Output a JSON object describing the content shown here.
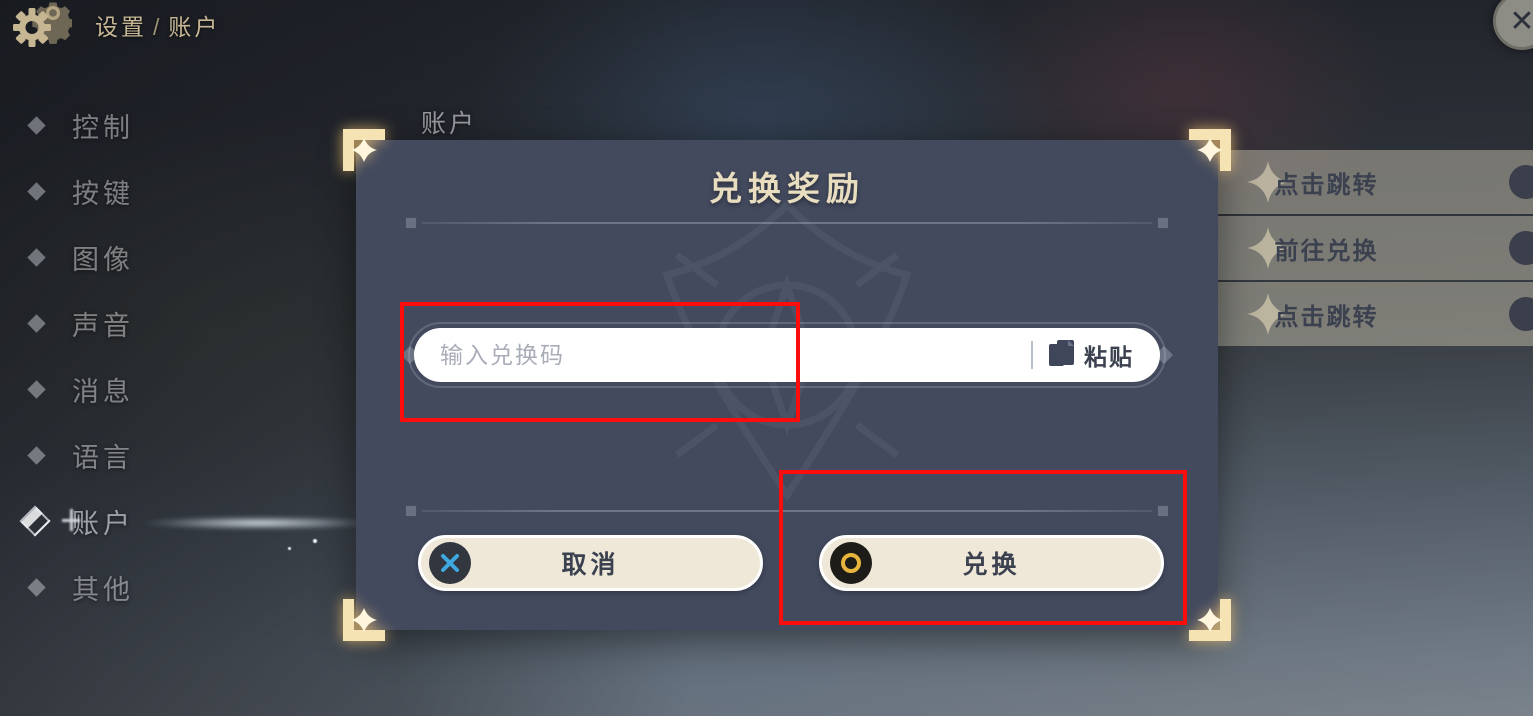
{
  "topbar": {
    "gear_icon": "gear-icon",
    "breadcrumb_root": "设置",
    "breadcrumb_sep": "/",
    "breadcrumb_current": "账户",
    "close_icon": "✕"
  },
  "sidebar": {
    "items": [
      {
        "label": "控制",
        "active": false
      },
      {
        "label": "按键",
        "active": false
      },
      {
        "label": "图像",
        "active": false
      },
      {
        "label": "声音",
        "active": false
      },
      {
        "label": "消息",
        "active": false
      },
      {
        "label": "语言",
        "active": false
      },
      {
        "label": "账户",
        "active": true
      },
      {
        "label": "其他",
        "active": false
      }
    ]
  },
  "panel": {
    "title": "账户",
    "rows": [
      {
        "action": "点击跳转"
      },
      {
        "action": "前往兑换"
      },
      {
        "action": "点击跳转"
      }
    ]
  },
  "modal": {
    "title": "兑换奖励",
    "input": {
      "placeholder": "输入兑换码",
      "value": "",
      "paste_label": "粘贴",
      "paste_icon": "clipboard-icon"
    },
    "buttons": {
      "cancel_label": "取消",
      "cancel_icon": "close-circle-icon",
      "redeem_label": "兑换",
      "redeem_icon": "ring-circle-icon"
    }
  },
  "annotations": {
    "input_box": "highlight-input",
    "redeem_box": "highlight-redeem"
  },
  "colors": {
    "modal_bg": "#434a5e",
    "gold": "#e9ddc0",
    "button_bg": "#efe8d9",
    "annotation": "#fb0d0d",
    "cancel_blue": "#3ea8e0",
    "redeem_gold": "#e8b53c"
  }
}
